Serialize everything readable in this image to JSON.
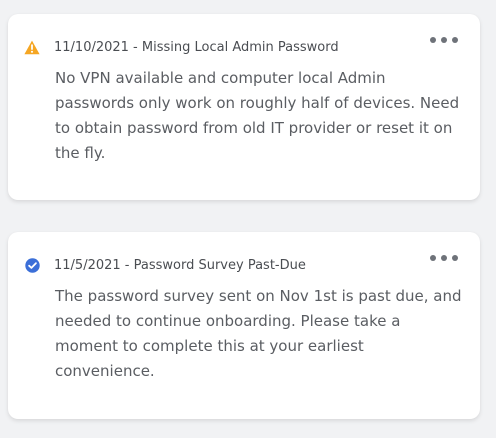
{
  "notifications": [
    {
      "icon": "warning-triangle-icon",
      "icon_color": "#f5a623",
      "title": "11/10/2021 - Missing Local Admin Password",
      "body": "No VPN available and computer local Admin passwords only work on roughly half of devices. Need to obtain password from old IT provider or reset it on the fly."
    },
    {
      "icon": "check-circle-icon",
      "icon_color": "#3b6fd8",
      "title": "11/5/2021 - Password Survey Past-Due",
      "body": "The password survey sent on Nov 1st is past due, and needed to continue onboarding. Please take a moment to complete this at your earliest convenience."
    }
  ]
}
